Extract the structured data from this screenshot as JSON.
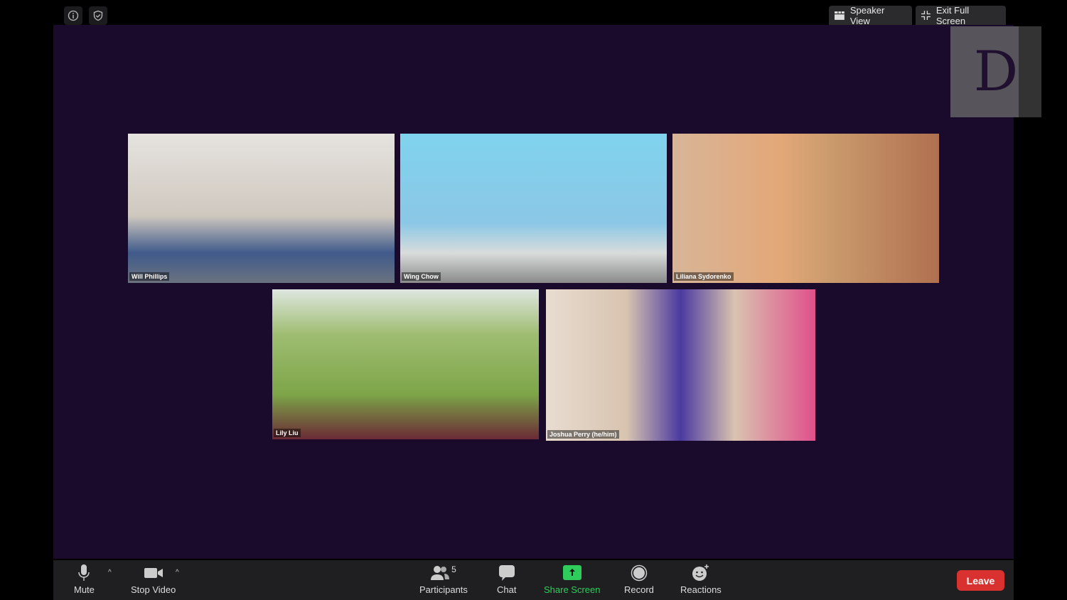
{
  "top_bar": {
    "speaker_view": "Speaker View",
    "exit_full_screen": "Exit Full Screen",
    "icons": [
      "info-icon",
      "shield-check-icon"
    ]
  },
  "self_view": {
    "logo_letter": "D"
  },
  "participants": [
    {
      "name": "Will Phillips"
    },
    {
      "name": "Wing Chow"
    },
    {
      "name": "Liliana Sydorenko"
    },
    {
      "name": "Lily Liu"
    },
    {
      "name": "Joshua Perry (he/him)"
    }
  ],
  "toolbar": {
    "mute": "Mute",
    "stop_video": "Stop Video",
    "participants": "Participants",
    "participant_count": "5",
    "chat": "Chat",
    "share_screen": "Share Screen",
    "record": "Record",
    "reactions": "Reactions",
    "leave": "Leave"
  },
  "colors": {
    "stage": "#1a0a2c",
    "share_accent": "#2ecc5a",
    "leave": "#d9312f"
  }
}
